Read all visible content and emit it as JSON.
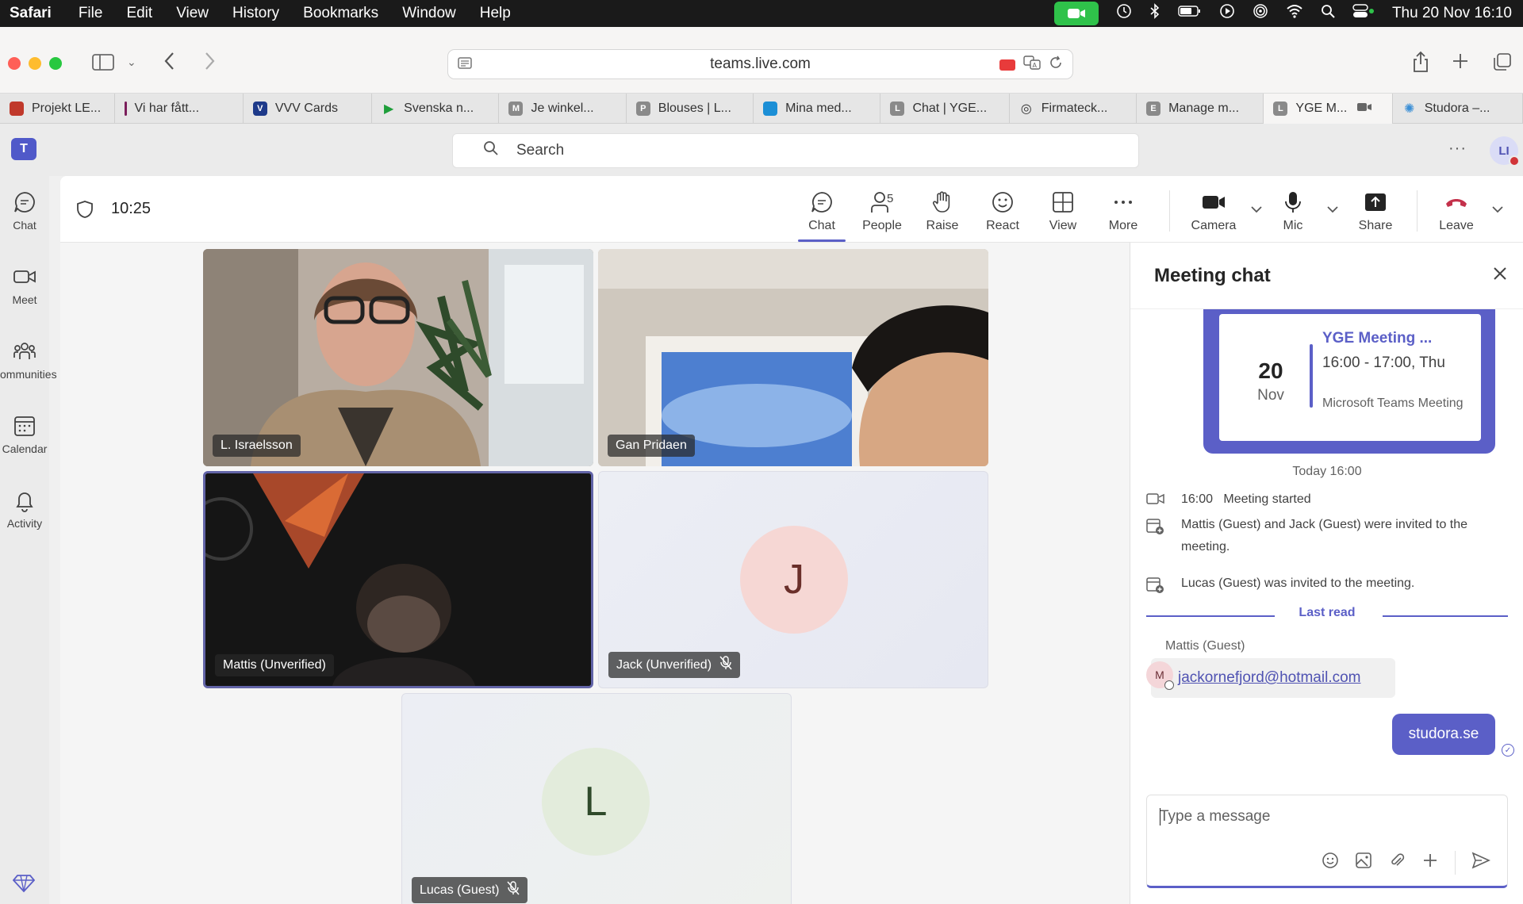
{
  "menubar": {
    "app": "Safari",
    "items": [
      "File",
      "Edit",
      "View",
      "History",
      "Bookmarks",
      "Window",
      "Help"
    ],
    "clock": "Thu 20 Nov  16:10"
  },
  "browser": {
    "url": "teams.live.com",
    "tabs": [
      {
        "label": "Projekt LE...",
        "fav_color": "#c0392b",
        "fav_glyph": ""
      },
      {
        "label": "Vi har fått...",
        "fav_color": "#7b1e5b",
        "fav_glyph": ""
      },
      {
        "label": "VVV Cards",
        "fav_color": "#1e3a8a",
        "fav_glyph": "V"
      },
      {
        "label": "Svenska n...",
        "fav_color": "#1e9e3a",
        "fav_glyph": "▶"
      },
      {
        "label": "Je winkel...",
        "fav_color": "#8a8a8a",
        "fav_glyph": "M"
      },
      {
        "label": "Blouses | L...",
        "fav_color": "#8a8a8a",
        "fav_glyph": "P"
      },
      {
        "label": "Mina med...",
        "fav_color": "#1c8fd6",
        "fav_glyph": ""
      },
      {
        "label": "Chat | YGE...",
        "fav_color": "#8a8a8a",
        "fav_glyph": "L"
      },
      {
        "label": "Firmateck...",
        "fav_color": "#333333",
        "fav_glyph": "◎"
      },
      {
        "label": "Manage m...",
        "fav_color": "#8a8a8a",
        "fav_glyph": "E"
      },
      {
        "label": "YGE M...",
        "fav_color": "#8a8a8a",
        "fav_glyph": "L"
      },
      {
        "label": "Studora –...",
        "fav_color": "#3b8fd6",
        "fav_glyph": "✺"
      }
    ]
  },
  "teams": {
    "search_placeholder": "Search",
    "user_initials": "LI",
    "rail": [
      {
        "label": "Chat",
        "icon": "chat-bubble-icon"
      },
      {
        "label": "Meet",
        "icon": "video-camera-icon"
      },
      {
        "label": "ommunities",
        "icon": "communities-icon"
      },
      {
        "label": "Calendar",
        "icon": "calendar-icon"
      },
      {
        "label": "Activity",
        "icon": "bell-icon"
      }
    ]
  },
  "meeting": {
    "timer": "10:25",
    "controls": {
      "chat": "Chat",
      "people": "People",
      "people_count": "5",
      "raise": "Raise",
      "react": "React",
      "view": "View",
      "more": "More",
      "camera": "Camera",
      "mic": "Mic",
      "share": "Share",
      "leave": "Leave"
    },
    "participants": [
      {
        "name": "L. Israelsson"
      },
      {
        "name": "Gan Pridaen"
      },
      {
        "name": "Mattis (Unverified)"
      },
      {
        "name": "Jack (Unverified)",
        "initial": "J",
        "muted": true
      },
      {
        "name": "Lucas (Guest)",
        "initial": "L",
        "muted": true
      }
    ]
  },
  "chat": {
    "title": "Meeting chat",
    "card": {
      "day": "20",
      "month": "Nov",
      "title": "YGE Meeting ...",
      "time": "16:00 - 17:00, Thu",
      "subtitle": "Microsoft Teams Meeting"
    },
    "today_label": "Today 16:00",
    "events": [
      {
        "time": "16:00",
        "text": "Meeting started",
        "icon": "video-camera-icon"
      },
      {
        "text": "Mattis (Guest) and Jack (Guest) were invited to the meeting.",
        "icon": "calendar-add-icon"
      },
      {
        "text": "Lucas (Guest) was invited to the meeting.",
        "icon": "calendar-add-icon"
      }
    ],
    "last_read": "Last read",
    "incoming": {
      "sender": "Mattis (Guest)",
      "avatar": "M",
      "text": "jackornefjord@hotmail.com"
    },
    "outgoing": {
      "text": "studora.se"
    },
    "composer_placeholder": "Type a message"
  }
}
